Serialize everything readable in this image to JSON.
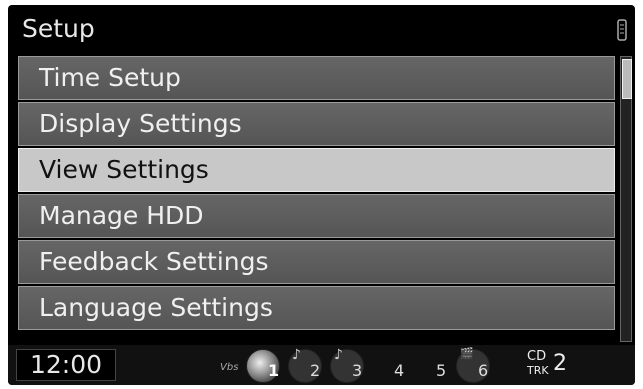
{
  "title": "Setup",
  "menu": {
    "items": [
      {
        "label": "Time Setup"
      },
      {
        "label": "Display Settings"
      },
      {
        "label": "View Settings"
      },
      {
        "label": "Manage HDD"
      },
      {
        "label": "Feedback Settings"
      },
      {
        "label": "Language Settings"
      }
    ],
    "selected_index": 2
  },
  "scroll_position": 0,
  "status": {
    "clock": "12:00",
    "vbr": "Vbs",
    "discs": [
      {
        "number": "1",
        "icon": "cd-disc-icon",
        "active": true
      },
      {
        "number": "2",
        "icon": "music-note-icon",
        "active": false
      },
      {
        "number": "3",
        "icon": "music-note-icon",
        "active": false
      },
      {
        "number": "4",
        "icon": "",
        "active": false
      },
      {
        "number": "5",
        "icon": "",
        "active": false
      },
      {
        "number": "6",
        "icon": "film-icon",
        "active": false
      }
    ],
    "source": "CD",
    "track_label": "TRK",
    "track_number": "2"
  }
}
